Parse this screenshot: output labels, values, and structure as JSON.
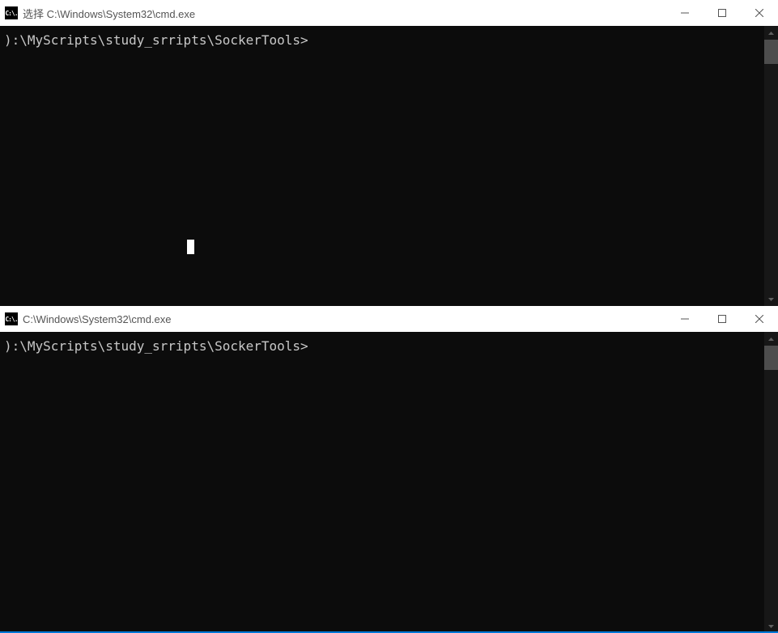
{
  "window1": {
    "title": "选择 C:\\Windows\\System32\\cmd.exe",
    "icon_text": "C:\\.",
    "prompt": "):\\MyScripts\\study_srripts\\SockerTools>"
  },
  "window2": {
    "title": "C:\\Windows\\System32\\cmd.exe",
    "icon_text": "C:\\.",
    "prompt": "):\\MyScripts\\study_srripts\\SockerTools>"
  },
  "controls": {
    "minimize": "minimize",
    "maximize": "maximize",
    "close": "close"
  }
}
